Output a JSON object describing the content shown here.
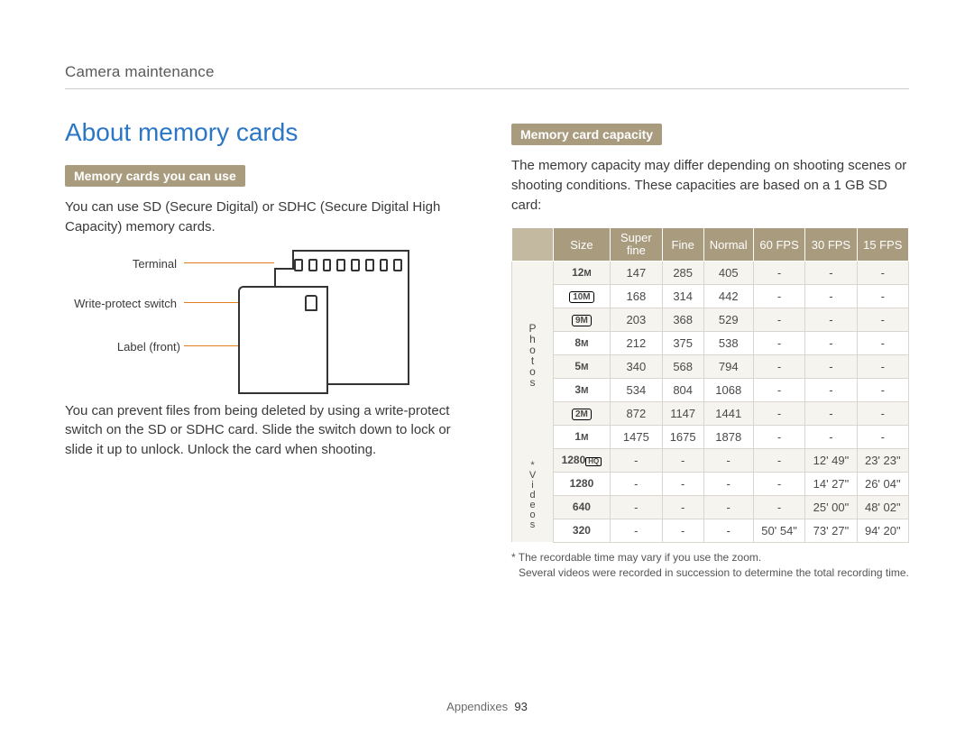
{
  "header": {
    "breadcrumb": "Camera maintenance"
  },
  "left": {
    "heading": "About memory cards",
    "banner1": "Memory cards you can use",
    "para1": "You can use SD (Secure Digital) or SDHC (Secure Digital High Capacity) memory cards.",
    "diag": {
      "terminal": "Terminal",
      "wpswitch": "Write-protect switch",
      "label": "Label (front)"
    },
    "para2": "You can prevent files from being deleted by using a write-protect switch on the SD or SDHC card. Slide the switch down to lock or slide it up to unlock. Unlock the card when shooting."
  },
  "right": {
    "banner2": "Memory card capacity",
    "intro": "The memory capacity may differ depending on shooting scenes or shooting conditions. These capacities are based on a 1 GB SD card:",
    "table": {
      "head": [
        "Size",
        "Super fine",
        "Fine",
        "Normal",
        "60 FPS",
        "30 FPS",
        "15 FPS"
      ],
      "groups": {
        "photos_label": "Photos",
        "videos_label": "* Videos"
      },
      "photos": [
        {
          "size": "12M",
          "sf": "147",
          "f": "285",
          "n": "405",
          "f60": "-",
          "f30": "-",
          "f15": "-"
        },
        {
          "size": "10Mw",
          "sf": "168",
          "f": "314",
          "n": "442",
          "f60": "-",
          "f30": "-",
          "f15": "-"
        },
        {
          "size": "9Mw",
          "sf": "203",
          "f": "368",
          "n": "529",
          "f60": "-",
          "f30": "-",
          "f15": "-"
        },
        {
          "size": "8M",
          "sf": "212",
          "f": "375",
          "n": "538",
          "f60": "-",
          "f30": "-",
          "f15": "-"
        },
        {
          "size": "5M",
          "sf": "340",
          "f": "568",
          "n": "794",
          "f60": "-",
          "f30": "-",
          "f15": "-"
        },
        {
          "size": "3M",
          "sf": "534",
          "f": "804",
          "n": "1068",
          "f60": "-",
          "f30": "-",
          "f15": "-"
        },
        {
          "size": "2Mw",
          "sf": "872",
          "f": "1147",
          "n": "1441",
          "f60": "-",
          "f30": "-",
          "f15": "-"
        },
        {
          "size": "1M",
          "sf": "1475",
          "f": "1675",
          "n": "1878",
          "f60": "-",
          "f30": "-",
          "f15": "-"
        }
      ],
      "videos": [
        {
          "size": "1280HQ",
          "sf": "-",
          "f": "-",
          "n": "-",
          "f60": "-",
          "f30": "12' 49\"",
          "f15": "23' 23\""
        },
        {
          "size": "1280",
          "sf": "-",
          "f": "-",
          "n": "-",
          "f60": "-",
          "f30": "14' 27\"",
          "f15": "26' 04\""
        },
        {
          "size": "640",
          "sf": "-",
          "f": "-",
          "n": "-",
          "f60": "-",
          "f30": "25' 00\"",
          "f15": "48' 02\""
        },
        {
          "size": "320",
          "sf": "-",
          "f": "-",
          "n": "-",
          "f60": "50' 54\"",
          "f30": "73' 27\"",
          "f15": "94' 20\""
        }
      ]
    },
    "note1": "* The recordable time may vary if you use the zoom.",
    "note2": "Several videos were recorded in succession to determine the total recording time."
  },
  "footer": {
    "section": "Appendixes",
    "page": "93"
  }
}
